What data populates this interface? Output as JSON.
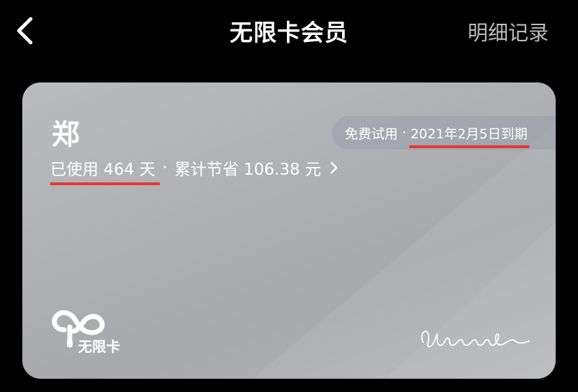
{
  "header": {
    "title": "无限卡会员",
    "records_label": "明细记录",
    "back_icon": "chevron-left-icon"
  },
  "card": {
    "holder": "郑",
    "used_text": "已使用 464 天",
    "separator": "·",
    "savings_text": "累计节省 106.38 元",
    "trial_label": "免费试用",
    "trial_separator": "·",
    "expiry": "2021年2月5日到期",
    "brand": "无限卡",
    "brand_icon": "infinity-logo-icon",
    "signature_icon": "signature-icon",
    "accent_color": "#e8382d"
  }
}
